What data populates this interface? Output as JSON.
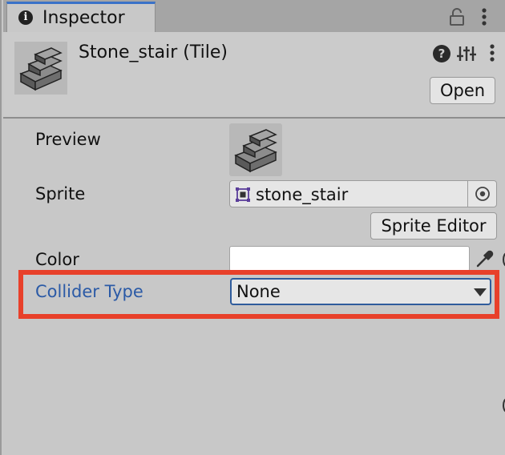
{
  "tab": {
    "title": "Inspector",
    "info_glyph": "i"
  },
  "header": {
    "asset_title": "Stone_stair (Tile)",
    "help_glyph": "?",
    "open_label": "Open"
  },
  "properties": {
    "preview_label": "Preview",
    "sprite_label": "Sprite",
    "sprite_value": "stone_stair",
    "sprite_editor_label": "Sprite Editor",
    "color_label": "Color",
    "color_value": "#ffffff",
    "collider_label": "Collider Type",
    "collider_value": "None"
  },
  "icons": {
    "tab": "info-icon",
    "lock": "lock-icon",
    "menu": "menu-dots-icon",
    "help": "help-icon",
    "presets": "sliders-icon",
    "sprite": "sprite-icon",
    "picker": "target-icon",
    "eyedropper": "eyedropper-icon",
    "dropdown": "chevron-down-icon"
  },
  "colors": {
    "tab_accent": "#3a72c8",
    "highlight": "#e8402a",
    "collider_label": "#2b5aa6"
  }
}
